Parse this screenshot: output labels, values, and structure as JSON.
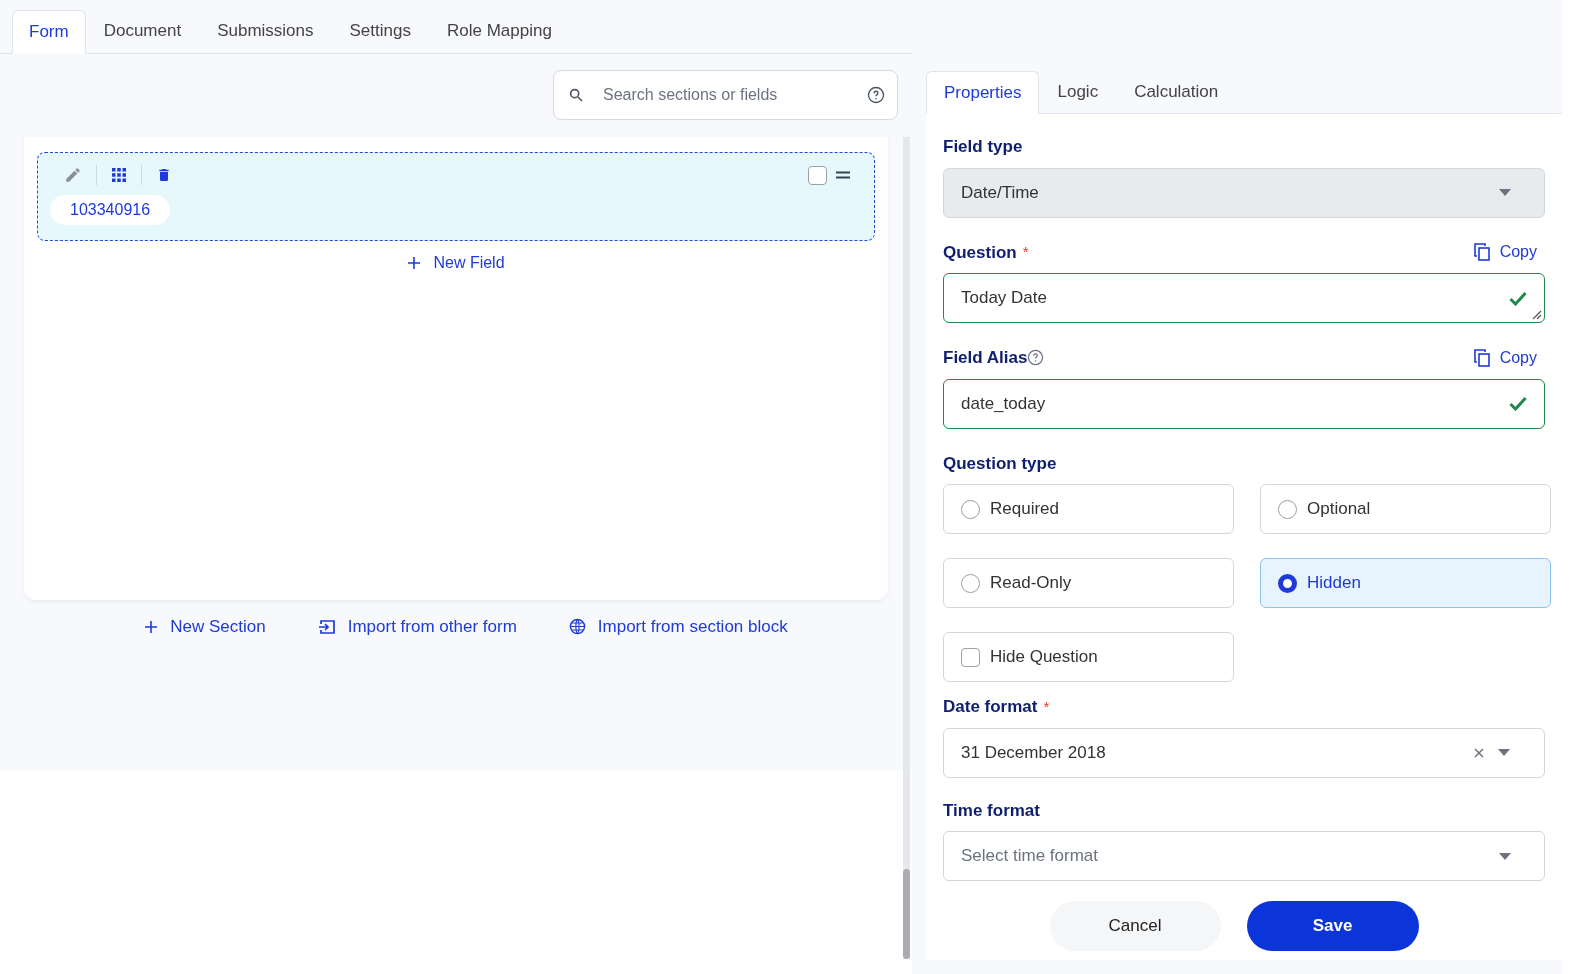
{
  "top_tabs": [
    {
      "label": "Form",
      "selected": true
    },
    {
      "label": "Document",
      "selected": false
    },
    {
      "label": "Submissions",
      "selected": false
    },
    {
      "label": "Settings",
      "selected": false
    },
    {
      "label": "Role Mapping",
      "selected": false
    }
  ],
  "search": {
    "placeholder": "Search sections or fields"
  },
  "field_card": {
    "chip": "103340916",
    "checked": false
  },
  "new_field": "New Field",
  "section_actions": [
    {
      "kind": "plus",
      "label": "New Section"
    },
    {
      "kind": "import",
      "label": "Import from other form"
    },
    {
      "kind": "globe",
      "label": "Import from section block"
    }
  ],
  "panel_tabs": [
    {
      "label": "Properties",
      "selected": true
    },
    {
      "label": "Logic",
      "selected": false
    },
    {
      "label": "Calculation",
      "selected": false
    }
  ],
  "field_type": {
    "label": "Field type",
    "value": "Date/Time"
  },
  "question": {
    "label": "Question",
    "required": true,
    "required_mark": "*",
    "copy": "Copy",
    "value": "Today Date",
    "valid": true
  },
  "field_alias": {
    "label": "Field Alias",
    "copy": "Copy",
    "value": "date_today",
    "valid": true
  },
  "question_type": {
    "label": "Question type",
    "options": [
      {
        "kind": "radio",
        "label": "Required",
        "selected": false
      },
      {
        "kind": "radio",
        "label": "Optional",
        "selected": false
      },
      {
        "kind": "radio",
        "label": "Read-Only",
        "selected": false
      },
      {
        "kind": "radio",
        "label": "Hidden",
        "selected": true
      },
      {
        "kind": "checkbox",
        "label": "Hide Question",
        "checked": false
      }
    ]
  },
  "date_format": {
    "label": "Date format",
    "required": true,
    "required_mark": "*",
    "value": "31 December 2018"
  },
  "time_format": {
    "label": "Time format",
    "placeholder": "Select time format"
  },
  "buttons": {
    "cancel": "Cancel",
    "save": "Save"
  }
}
